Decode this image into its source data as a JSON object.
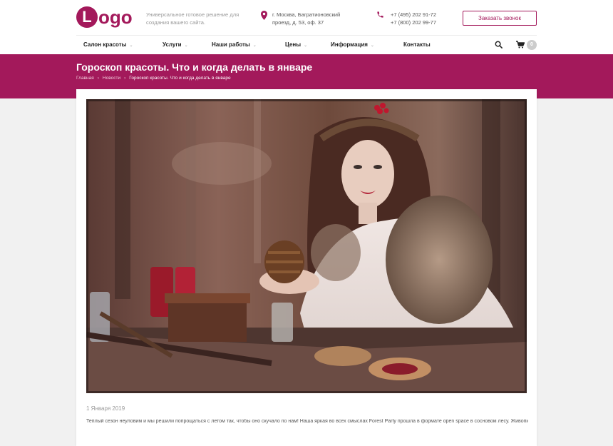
{
  "header": {
    "logo_letter": "L",
    "logo_text": "ogo",
    "tagline": "Универсальное готовое решение для создания вашего сайта.",
    "address_line1": "г. Москва, Багратионовский",
    "address_line2": "проезд, д. 53, оф. 37",
    "phone1": "+7 (495) 202 91-72",
    "phone2": "+7 (800) 202 99-77",
    "callback_label": "Заказать звонок"
  },
  "nav": {
    "items": [
      {
        "label": "Салон красоты",
        "has_dropdown": true
      },
      {
        "label": "Услуги",
        "has_dropdown": true
      },
      {
        "label": "Наши работы",
        "has_dropdown": true
      },
      {
        "label": "Цены",
        "has_dropdown": true
      },
      {
        "label": "Информация",
        "has_dropdown": true
      },
      {
        "label": "Контакты",
        "has_dropdown": false
      }
    ],
    "cart_count": "0"
  },
  "page": {
    "title": "Гороскоп красоты. Что и когда делать в январе",
    "breadcrumbs": [
      "Главная",
      "Новости",
      "Гороскоп красоты. Что и когда делать в январе"
    ]
  },
  "article": {
    "date": "1 Января 2019",
    "text": "Теплый сезон неуловим и мы решили попрощаться с летом так, чтобы оно скучало по нам! Наша яркая во всех смыслах Forest Party прошла в формате open space в сосновом лесу. Живописная природа в миксе с"
  },
  "icons": {
    "address": "map-pin-icon",
    "phone": "phone-icon",
    "search": "search-icon",
    "cart": "cart-icon",
    "chevron": "chevron-down-icon"
  },
  "colors": {
    "accent": "#a3195b",
    "background": "#f1f1f1"
  }
}
